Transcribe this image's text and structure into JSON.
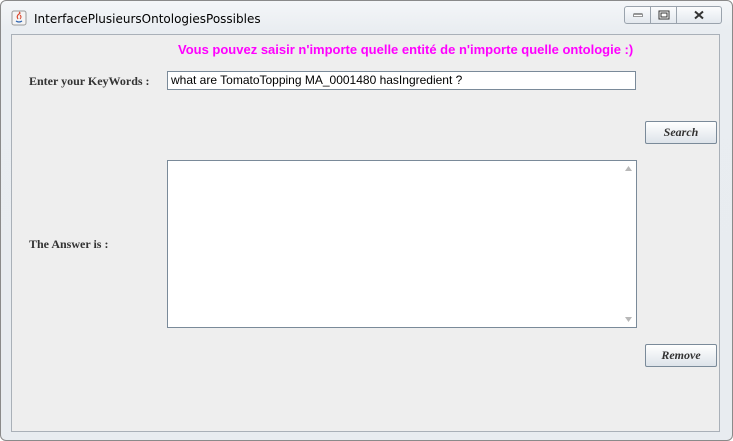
{
  "window": {
    "title": "InterfacePlusieursOntologiesPossibles",
    "icons": {
      "app": "java-icon",
      "minimize": "minimize-icon",
      "maximize": "maximize-icon",
      "close": "close-icon"
    }
  },
  "main": {
    "banner": "Vous pouvez saisir n'importe quelle entité de n'importe quelle ontologie :)",
    "keywords_label": "Enter your KeyWords :",
    "keywords_value": "what are TomatoTopping MA_0001480 hasIngredient ?",
    "search_label": "Search",
    "answer_label": "The Answer is :",
    "answer_value": "",
    "remove_label": "Remove"
  },
  "colors": {
    "banner": "#ff00ff",
    "panel": "#eeeeee",
    "label_text": "#333333"
  }
}
